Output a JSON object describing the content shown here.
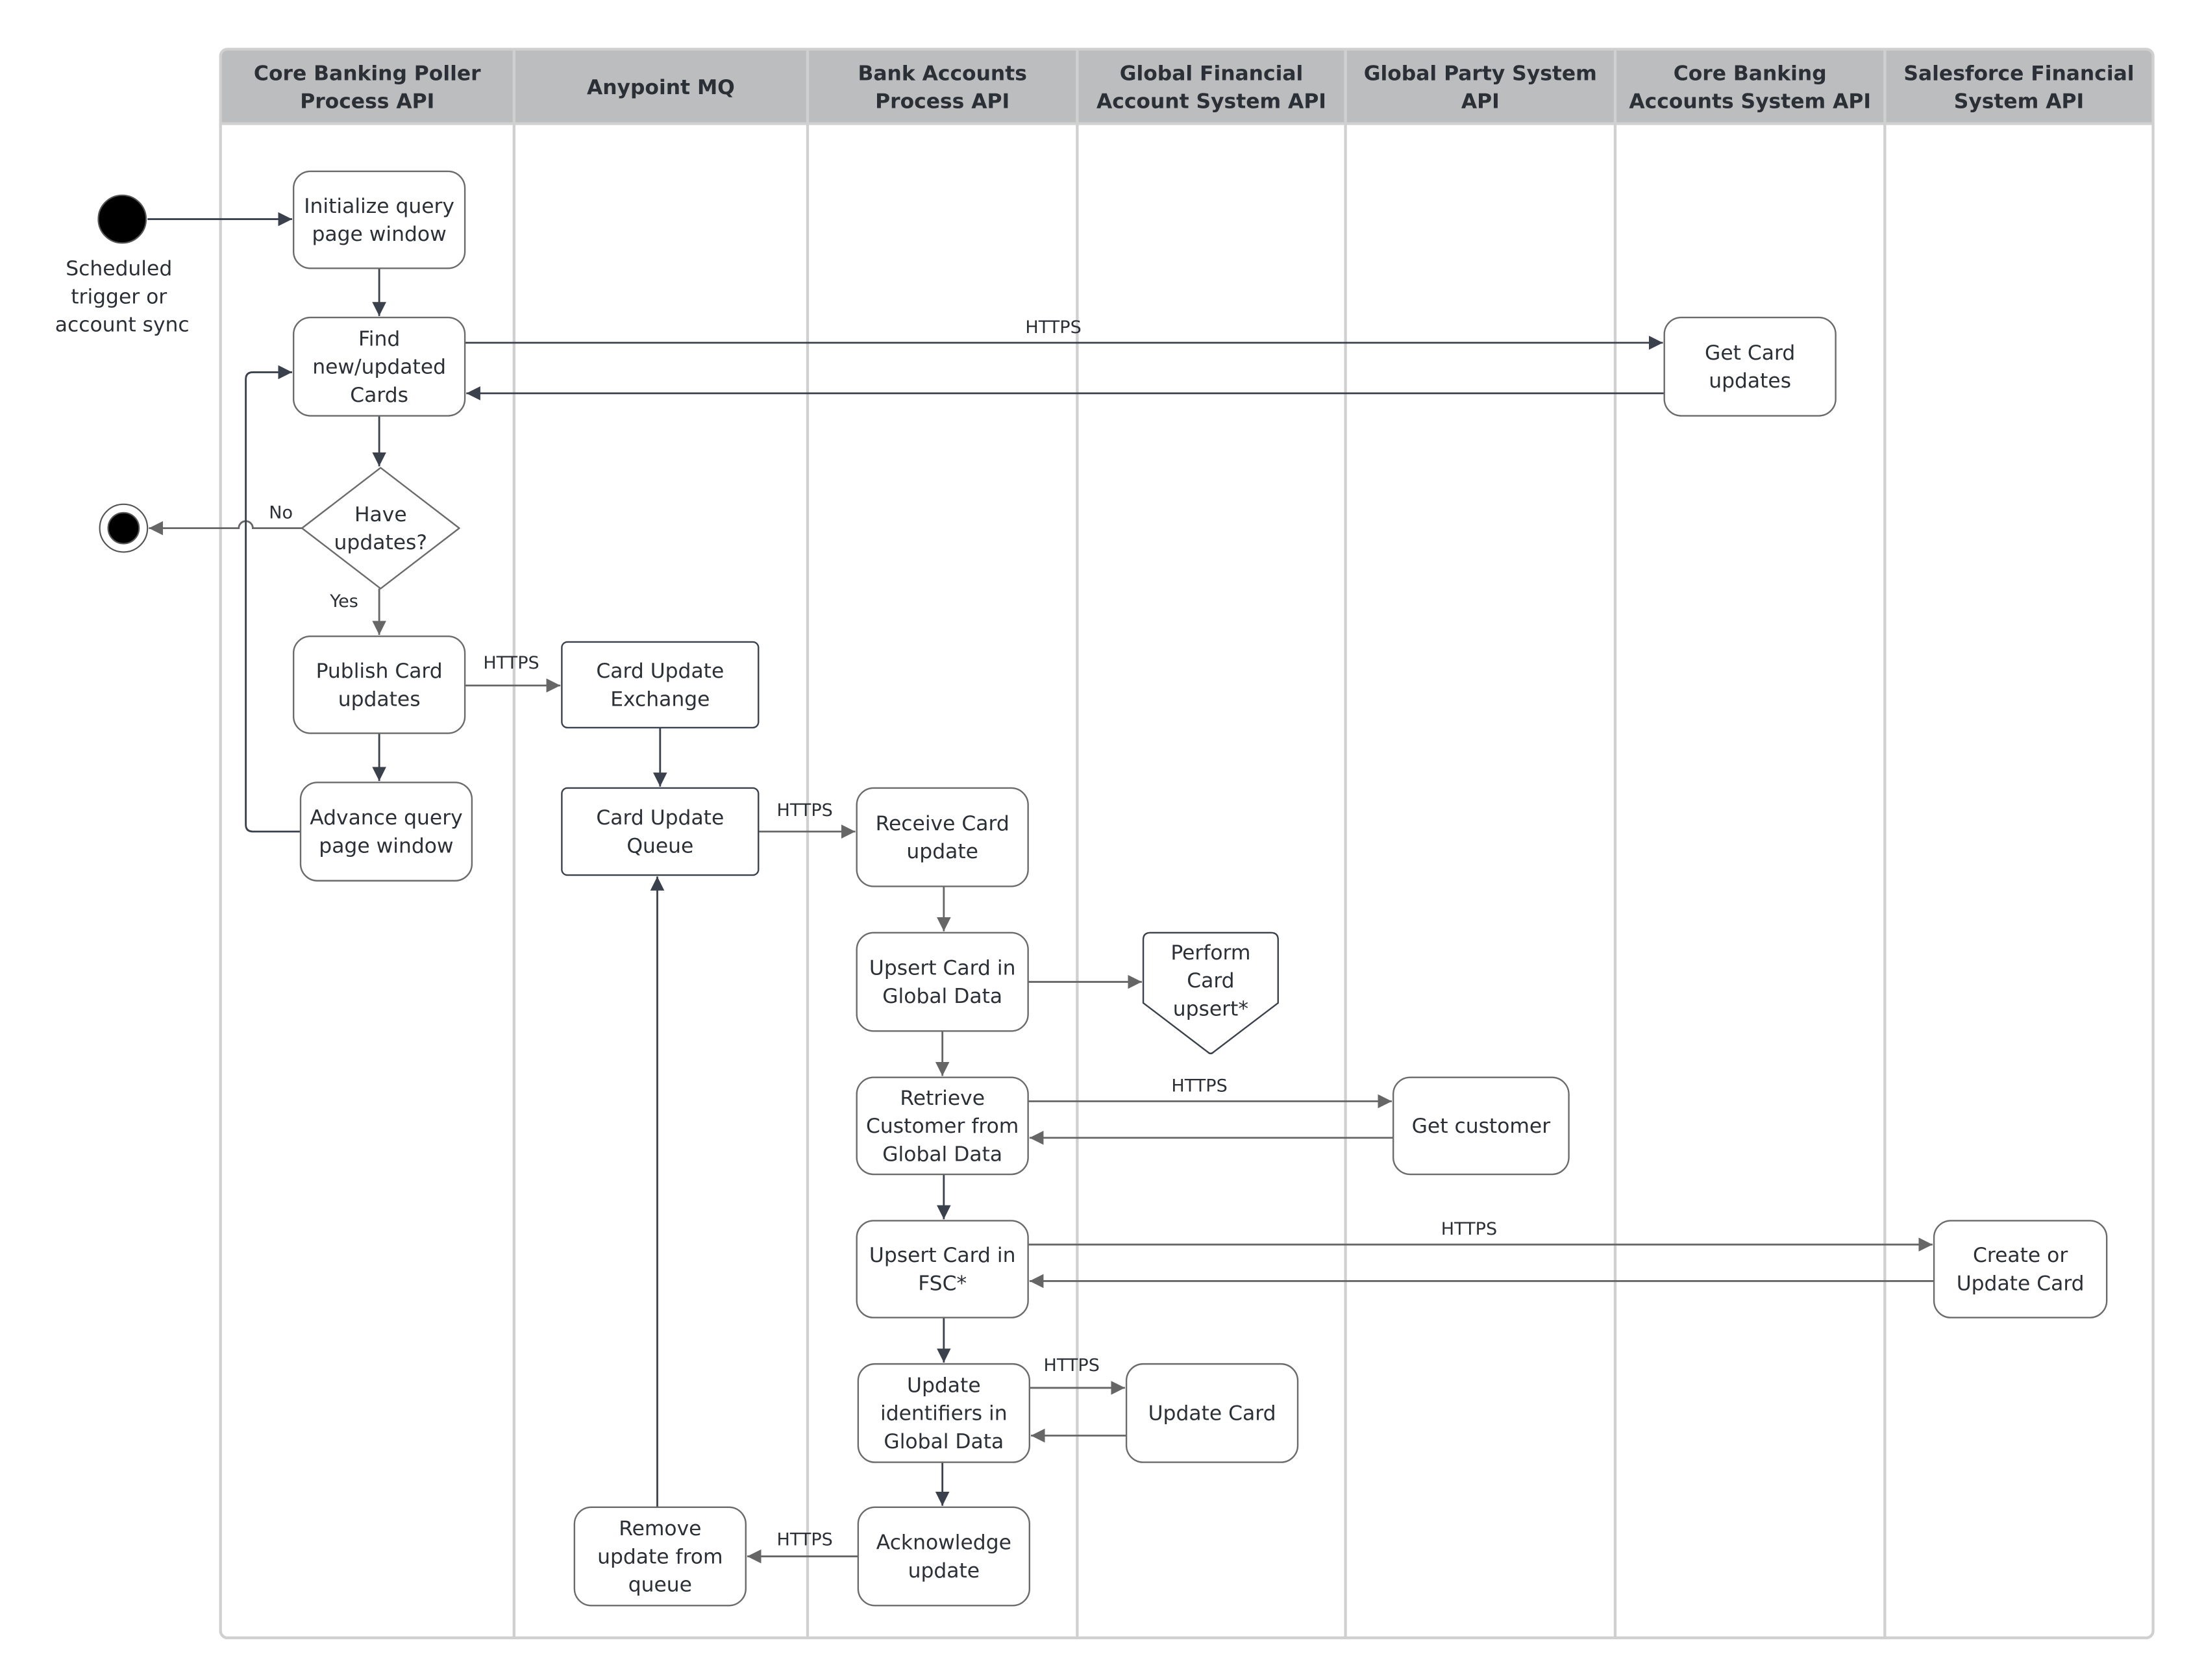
{
  "colors": {
    "header_bg": "#bcbdbf",
    "lane_border": "#d0d0d0",
    "node_border": "#6b6b6b",
    "queue_border": "#3a414c",
    "arrow_dark": "#3a414c",
    "arrow_gray": "#666666",
    "text": "#2b2f36",
    "terminal_fill": "#000000"
  },
  "lanes": [
    {
      "id": "poller",
      "title": [
        "Core Banking Poller",
        "Process API"
      ]
    },
    {
      "id": "mq",
      "title": [
        "Anypoint MQ"
      ]
    },
    {
      "id": "bank",
      "title": [
        "Bank Accounts",
        "Process API"
      ]
    },
    {
      "id": "gfa",
      "title": [
        "Global Financial",
        "Account System API"
      ]
    },
    {
      "id": "gps",
      "title": [
        "Global Party System",
        "API"
      ]
    },
    {
      "id": "cba",
      "title": [
        "Core Banking",
        "Accounts System API"
      ]
    },
    {
      "id": "sfs",
      "title": [
        "Salesforce Financial",
        "System API"
      ]
    }
  ],
  "start": {
    "label": [
      "Scheduled",
      "trigger or",
      "account sync"
    ]
  },
  "end": {
    "label": ""
  },
  "nodes": [
    {
      "id": "init",
      "lane": "poller",
      "shape": "rounded",
      "lines": [
        "Initialize query",
        "page window"
      ]
    },
    {
      "id": "find",
      "lane": "poller",
      "shape": "rounded",
      "lines": [
        "Find",
        "new/updated",
        "Cards"
      ]
    },
    {
      "id": "decision",
      "lane": "poller",
      "shape": "diamond",
      "lines": [
        "Have",
        "updates?"
      ]
    },
    {
      "id": "publish",
      "lane": "poller",
      "shape": "rounded",
      "lines": [
        "Publish Card",
        "updates"
      ]
    },
    {
      "id": "advance",
      "lane": "poller",
      "shape": "rounded",
      "lines": [
        "Advance query",
        "page window"
      ]
    },
    {
      "id": "exchange",
      "lane": "mq",
      "shape": "rect",
      "lines": [
        "Card Update",
        "Exchange"
      ]
    },
    {
      "id": "queue",
      "lane": "mq",
      "shape": "rect",
      "lines": [
        "Card Update",
        "Queue"
      ]
    },
    {
      "id": "remove",
      "lane": "mq",
      "shape": "rounded",
      "lines": [
        "Remove",
        "update from",
        "queue"
      ]
    },
    {
      "id": "receive",
      "lane": "bank",
      "shape": "rounded",
      "lines": [
        "Receive Card",
        "update"
      ]
    },
    {
      "id": "upsert_gd",
      "lane": "bank",
      "shape": "rounded",
      "lines": [
        "Upsert Card in",
        "Global Data"
      ]
    },
    {
      "id": "retrieve",
      "lane": "bank",
      "shape": "rounded",
      "lines": [
        "Retrieve",
        "Customer from",
        "Global Data"
      ]
    },
    {
      "id": "upsert_fsc",
      "lane": "bank",
      "shape": "rounded",
      "lines": [
        "Upsert Card in",
        "FSC*"
      ]
    },
    {
      "id": "update_ids",
      "lane": "bank",
      "shape": "rounded",
      "lines": [
        "Update",
        "identifiers in",
        "Global Data"
      ]
    },
    {
      "id": "ack",
      "lane": "bank",
      "shape": "rounded",
      "lines": [
        "Acknowledge",
        "update"
      ]
    },
    {
      "id": "perform",
      "lane": "gfa",
      "shape": "offpage",
      "lines": [
        "Perform",
        "Card",
        "upsert*"
      ]
    },
    {
      "id": "update_card",
      "lane": "gfa",
      "shape": "rounded",
      "lines": [
        "Update Card"
      ]
    },
    {
      "id": "get_customer",
      "lane": "gps",
      "shape": "rounded",
      "lines": [
        "Get customer"
      ]
    },
    {
      "id": "get_updates",
      "lane": "cba",
      "shape": "rounded",
      "lines": [
        "Get Card",
        "updates"
      ]
    },
    {
      "id": "create_update",
      "lane": "sfs",
      "shape": "rounded",
      "lines": [
        "Create or",
        "Update Card"
      ]
    }
  ],
  "edges": [
    {
      "from": "start",
      "to": "init",
      "label": ""
    },
    {
      "from": "init",
      "to": "find",
      "label": ""
    },
    {
      "from": "find",
      "to": "get_updates",
      "label": "HTTPS"
    },
    {
      "from": "get_updates",
      "to": "find",
      "label": ""
    },
    {
      "from": "find",
      "to": "decision",
      "label": ""
    },
    {
      "from": "decision",
      "to": "end",
      "label": "No"
    },
    {
      "from": "decision",
      "to": "publish",
      "label": "Yes"
    },
    {
      "from": "publish",
      "to": "exchange",
      "label": "HTTPS"
    },
    {
      "from": "publish",
      "to": "advance",
      "label": ""
    },
    {
      "from": "advance",
      "to": "find",
      "label": ""
    },
    {
      "from": "exchange",
      "to": "queue",
      "label": ""
    },
    {
      "from": "queue",
      "to": "receive",
      "label": "HTTPS"
    },
    {
      "from": "receive",
      "to": "upsert_gd",
      "label": ""
    },
    {
      "from": "upsert_gd",
      "to": "perform",
      "label": ""
    },
    {
      "from": "upsert_gd",
      "to": "retrieve",
      "label": ""
    },
    {
      "from": "retrieve",
      "to": "get_customer",
      "label": "HTTPS"
    },
    {
      "from": "get_customer",
      "to": "retrieve",
      "label": ""
    },
    {
      "from": "retrieve",
      "to": "upsert_fsc",
      "label": ""
    },
    {
      "from": "upsert_fsc",
      "to": "create_update",
      "label": "HTTPS"
    },
    {
      "from": "create_update",
      "to": "upsert_fsc",
      "label": ""
    },
    {
      "from": "upsert_fsc",
      "to": "update_ids",
      "label": ""
    },
    {
      "from": "update_ids",
      "to": "update_card",
      "label": "HTTPS"
    },
    {
      "from": "update_card",
      "to": "update_ids",
      "label": ""
    },
    {
      "from": "update_ids",
      "to": "ack",
      "label": ""
    },
    {
      "from": "ack",
      "to": "remove",
      "label": "HTTPS"
    },
    {
      "from": "remove",
      "to": "queue",
      "label": ""
    }
  ]
}
